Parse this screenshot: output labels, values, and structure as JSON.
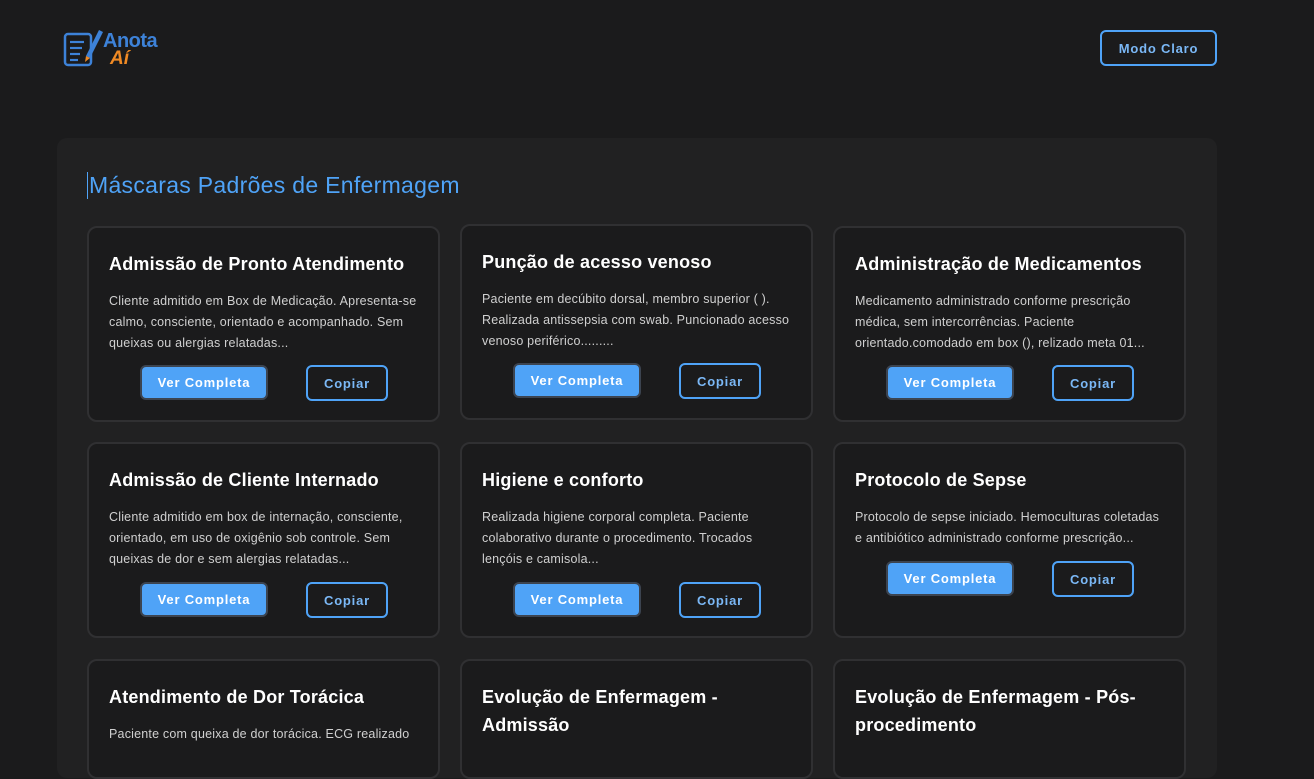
{
  "header": {
    "logo_text_1": "Anota",
    "logo_text_2": "Aí",
    "mode_button": "Modo Claro"
  },
  "section_title": "Máscaras Padrões de Enfermagem",
  "buttons": {
    "view": "Ver Completa",
    "copy": "Copiar"
  },
  "cards": [
    {
      "title": "Admissão de Pronto Atendimento",
      "text": "Cliente admitido em Box de Medicação. Apresenta-se calmo, consciente, orientado e acompanhado. Sem queixas ou alergias relatadas..."
    },
    {
      "title": "Punção de acesso venoso",
      "text": "Paciente em decúbito dorsal, membro superior ( ). Realizada antissepsia com swab. Puncionado acesso venoso periférico........."
    },
    {
      "title": "Administração de Medicamentos",
      "text": "Medicamento administrado conforme prescrição médica, sem intercorrências. Paciente orientado.comodado em box (), relizado meta 01..."
    },
    {
      "title": "Admissão de Cliente Internado",
      "text": "Cliente admitido em box de internação, consciente, orientado, em uso de oxigênio sob controle. Sem queixas de dor e sem alergias relatadas..."
    },
    {
      "title": "Higiene e conforto",
      "text": "Realizada higiene corporal completa. Paciente colaborativo durante o procedimento. Trocados lençóis e camisola..."
    },
    {
      "title": "Protocolo de Sepse",
      "text": "Protocolo de sepse iniciado. Hemoculturas coletadas e antibiótico administrado conforme prescrição..."
    },
    {
      "title": "Atendimento de Dor Torácica",
      "text": "Paciente com queixa de dor torácica. ECG realizado"
    },
    {
      "title": "Evolução de Enfermagem - Admissão",
      "text": ""
    },
    {
      "title": "Evolução de Enfermagem - Pós-procedimento",
      "text": ""
    }
  ],
  "colors": {
    "background": "#1b1b1c",
    "panel": "#212122",
    "accent": "#4fa3f7",
    "logo_blue": "#3d82d8",
    "logo_orange": "#f08a24"
  }
}
